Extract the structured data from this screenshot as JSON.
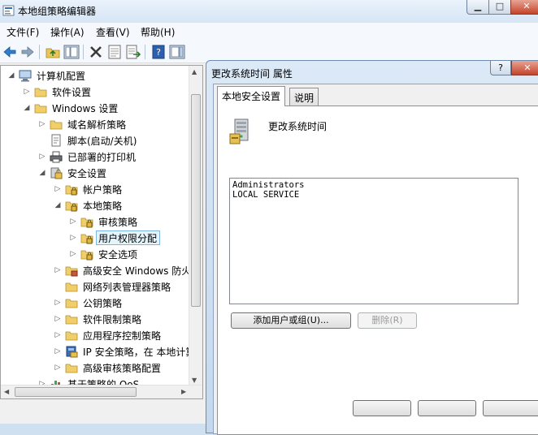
{
  "window": {
    "title": "本地组策略编辑器"
  },
  "menu": [
    {
      "label": "文件(F)"
    },
    {
      "label": "操作(A)"
    },
    {
      "label": "查看(V)"
    },
    {
      "label": "帮助(H)"
    }
  ],
  "tree": [
    {
      "label": "计算机配置",
      "indent": 0,
      "expander": "expanded",
      "icon": "computer-icon"
    },
    {
      "label": "软件设置",
      "indent": 1,
      "expander": "collapsed",
      "icon": "folder-icon"
    },
    {
      "label": "Windows 设置",
      "indent": 1,
      "expander": "expanded",
      "icon": "folder-icon"
    },
    {
      "label": "域名解析策略",
      "indent": 2,
      "expander": "collapsed",
      "icon": "folder-icon"
    },
    {
      "label": "脚本(启动/关机)",
      "indent": 2,
      "expander": "none",
      "icon": "script-icon"
    },
    {
      "label": "已部署的打印机",
      "indent": 2,
      "expander": "collapsed",
      "icon": "printer-icon"
    },
    {
      "label": "安全设置",
      "indent": 2,
      "expander": "expanded",
      "icon": "security-settings-icon"
    },
    {
      "label": "帐户策略",
      "indent": 3,
      "expander": "collapsed",
      "icon": "lock-folder-icon"
    },
    {
      "label": "本地策略",
      "indent": 3,
      "expander": "expanded",
      "icon": "lock-folder-icon"
    },
    {
      "label": "审核策略",
      "indent": 4,
      "expander": "collapsed",
      "icon": "lock-folder-icon"
    },
    {
      "label": "用户权限分配",
      "indent": 4,
      "expander": "collapsed",
      "icon": "lock-folder-icon",
      "selected": true
    },
    {
      "label": "安全选项",
      "indent": 4,
      "expander": "collapsed",
      "icon": "lock-folder-icon"
    },
    {
      "label": "高级安全 Windows 防火",
      "indent": 3,
      "expander": "collapsed",
      "icon": "firewall-folder-icon"
    },
    {
      "label": "网络列表管理器策略",
      "indent": 3,
      "expander": "none",
      "icon": "folder-icon"
    },
    {
      "label": "公钥策略",
      "indent": 3,
      "expander": "collapsed",
      "icon": "folder-icon"
    },
    {
      "label": "软件限制策略",
      "indent": 3,
      "expander": "collapsed",
      "icon": "folder-icon"
    },
    {
      "label": "应用程序控制策略",
      "indent": 3,
      "expander": "collapsed",
      "icon": "folder-icon"
    },
    {
      "label": "IP 安全策略，在 本地计算",
      "indent": 3,
      "expander": "collapsed",
      "icon": "ip-security-icon"
    },
    {
      "label": "高级审核策略配置",
      "indent": 3,
      "expander": "collapsed",
      "icon": "folder-icon"
    },
    {
      "label": "基于策略的 QoS",
      "indent": 2,
      "expander": "collapsed",
      "icon": "qos-chart-icon"
    }
  ],
  "dialog": {
    "title": "更改系统时间 属性",
    "help_label": "?",
    "close_label": "✕",
    "tabs": [
      {
        "label": "本地安全设置",
        "active": true
      },
      {
        "label": "说明",
        "active": false
      }
    ],
    "policy_name": "更改系统时间",
    "accounts": [
      "Administrators",
      "LOCAL SERVICE"
    ],
    "add_button": "添加用户或组(U)...",
    "remove_button": "删除(R)"
  }
}
